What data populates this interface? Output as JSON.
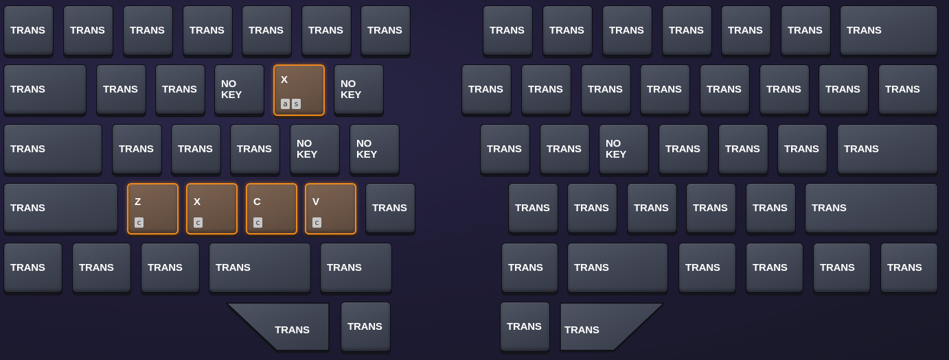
{
  "keyboard": {
    "left": {
      "row1": [
        "TRANS",
        "TRANS",
        "TRANS",
        "TRANS",
        "TRANS",
        "TRANS",
        "TRANS"
      ],
      "row2": [
        "TRANS",
        "TRANS",
        "TRANS",
        "NO\nKEY",
        "X",
        "NO\nKEY"
      ],
      "row2_x_subs": [
        "a",
        "s"
      ],
      "row3": [
        "TRANS",
        "TRANS",
        "TRANS",
        "TRANS",
        "NO\nKEY",
        "NO\nKEY"
      ],
      "row4": [
        "TRANS",
        "Z",
        "X",
        "C",
        "V",
        "TRANS"
      ],
      "row4_subs": [
        "c",
        "c",
        "c",
        "c"
      ],
      "row5": [
        "TRANS",
        "TRANS",
        "TRANS",
        "TRANS",
        "TRANS"
      ],
      "thumb": [
        "TRANS",
        "TRANS"
      ]
    },
    "right": {
      "row1": [
        "TRANS",
        "TRANS",
        "TRANS",
        "TRANS",
        "TRANS",
        "TRANS",
        "TRANS"
      ],
      "row2": [
        "TRANS",
        "TRANS",
        "TRANS",
        "TRANS",
        "TRANS",
        "TRANS",
        "TRANS",
        "TRANS"
      ],
      "row3": [
        "TRANS",
        "TRANS",
        "NO\nKEY",
        "TRANS",
        "TRANS",
        "TRANS",
        "TRANS"
      ],
      "row4": [
        "TRANS",
        "TRANS",
        "TRANS",
        "TRANS",
        "TRANS",
        "TRANS"
      ],
      "row5": [
        "TRANS",
        "TRANS",
        "TRANS",
        "TRANS",
        "TRANS",
        "TRANS"
      ],
      "thumb": [
        "TRANS",
        "TRANS"
      ]
    },
    "highlight_color": "#f08a1c",
    "key_color": "#434855",
    "highlight_fill": "#6f5848"
  }
}
